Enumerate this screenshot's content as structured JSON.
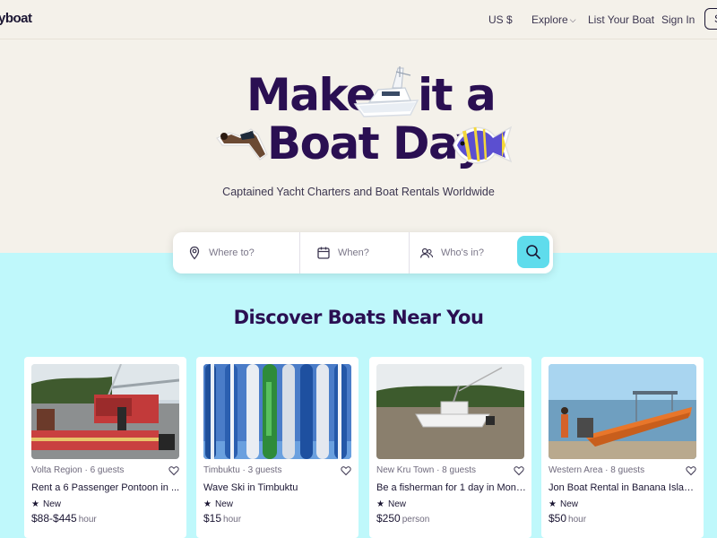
{
  "header": {
    "logo": "yboat",
    "currency": "US $",
    "explore": "Explore",
    "list_boat": "List Your Boat",
    "sign_in": "Sign In",
    "sign_up": "Si"
  },
  "hero": {
    "headline_part1": "Make",
    "headline_part2": "it a",
    "headline_line2": "Boat Day",
    "subtitle": "Captained Yacht Charters and Boat Rentals Worldwide"
  },
  "search": {
    "where_placeholder": "Where to?",
    "when_placeholder": "When?",
    "who_placeholder": "Who's in?"
  },
  "listings": {
    "heading": "Discover Boats Near You",
    "cards": [
      {
        "location": "Volta Region · 6 guests",
        "title": "Rent a 6 Passenger Pontoon in ...",
        "badge": "New",
        "price": "$88-$445",
        "unit": "hour"
      },
      {
        "location": "Timbuktu · 3 guests",
        "title": "Wave Ski in Timbuktu",
        "badge": "New",
        "price": "$15",
        "unit": "hour"
      },
      {
        "location": "New Kru Town · 8 guests",
        "title": "Be a fisherman for 1 day in Monr...",
        "badge": "New",
        "price": "$250",
        "unit": "person"
      },
      {
        "location": "Western Area · 8 guests",
        "title": "Jon Boat Rental in Banana Islands",
        "badge": "New",
        "price": "$50",
        "unit": "hour"
      }
    ]
  },
  "colors": {
    "brand_purple": "#2a0f52",
    "accent_cyan": "#5fdcec",
    "section_bg": "#bff8fb",
    "hero_bg": "#f4f1ea"
  }
}
